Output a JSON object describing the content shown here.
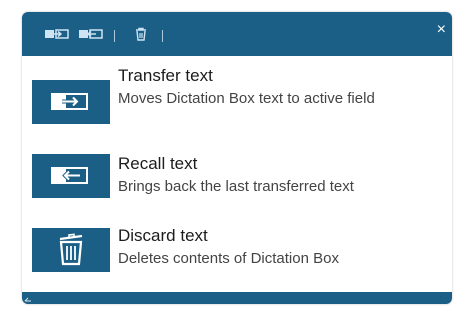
{
  "window": {
    "close_glyph": "×"
  },
  "toolbar": {
    "buttons": [
      {
        "name": "transfer-text-tool",
        "icon": "transfer-icon"
      },
      {
        "name": "recall-text-tool",
        "icon": "recall-icon"
      },
      {
        "name": "discard-text-tool",
        "icon": "trash-icon"
      }
    ]
  },
  "actions": [
    {
      "title": "Transfer text",
      "description": "Moves Dictation Box text to active field",
      "icon": "transfer-icon"
    },
    {
      "title": "Recall text",
      "description": "Brings back the last transferred text",
      "icon": "recall-icon"
    },
    {
      "title": "Discard text",
      "description": "Deletes contents of Dictation Box",
      "icon": "trash-icon"
    }
  ],
  "colors": {
    "accent": "#1b5f86",
    "title_text": "#1c1c1c",
    "description_text": "#444444"
  }
}
